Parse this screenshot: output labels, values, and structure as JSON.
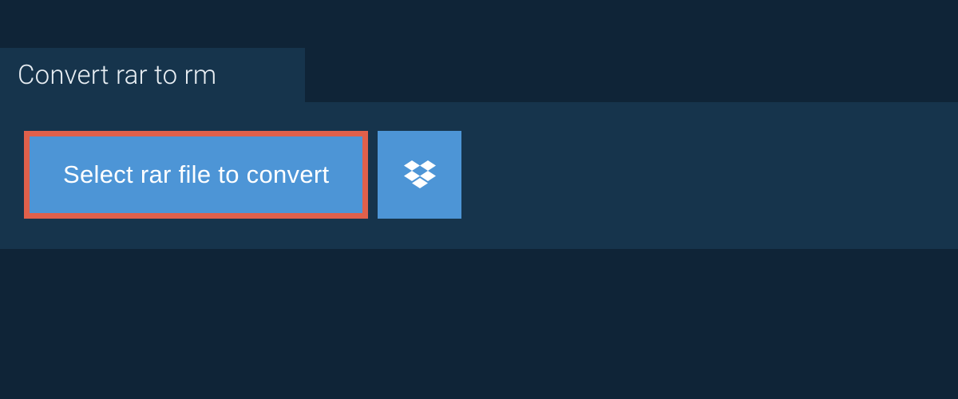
{
  "header": {
    "tab_title": "Convert rar to rm"
  },
  "actions": {
    "select_file_label": "Select rar file to convert",
    "cloud_source": "dropbox"
  },
  "colors": {
    "page_bg": "#0f2437",
    "panel_bg": "#16344c",
    "button_bg": "#4d95d6",
    "highlight_border": "#e0604b",
    "text_light": "#e8eef3"
  }
}
